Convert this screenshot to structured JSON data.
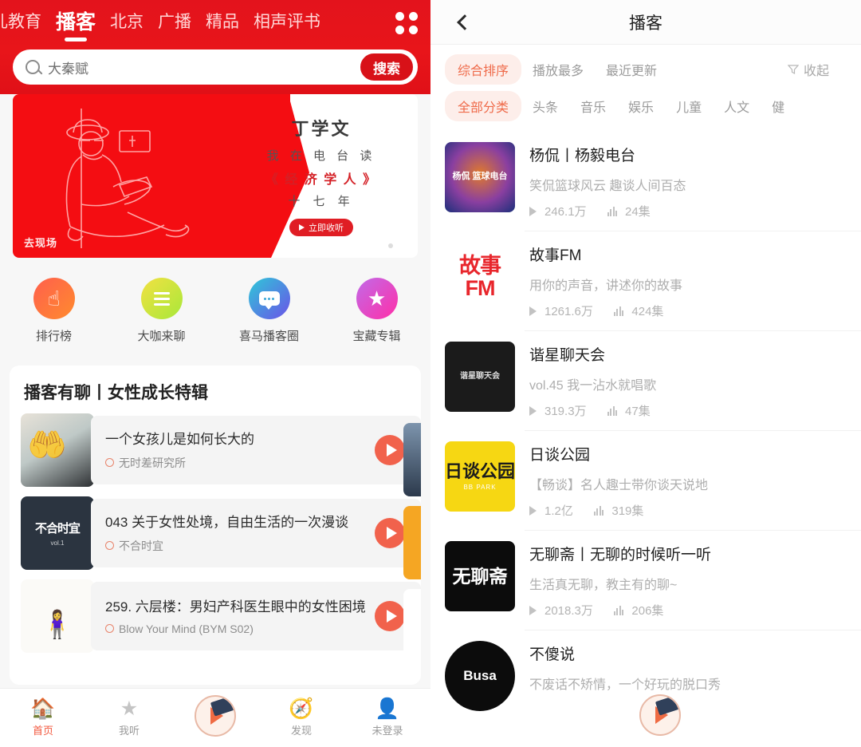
{
  "left": {
    "top_tabs": [
      {
        "label": "少儿教育",
        "active": false
      },
      {
        "label": "播客",
        "active": true
      },
      {
        "label": "北京",
        "active": false
      },
      {
        "label": "广播",
        "active": false
      },
      {
        "label": "精品",
        "active": false
      },
      {
        "label": "相声评书",
        "active": false
      }
    ],
    "grid_icon": "grid-apps-icon",
    "search": {
      "icon": "search-icon",
      "value": "大秦赋",
      "button_label": "搜索"
    },
    "banner": {
      "name": "丁学文",
      "line2": "我 在 电 台 读",
      "line3": "《 经 济 学 人 》",
      "line4": "十 七 年",
      "cta_label": "立即收听",
      "brand": "去现场",
      "dots": 3,
      "active_dot": 1
    },
    "entries": [
      {
        "label": "排行榜",
        "icon": "hand-tap-icon"
      },
      {
        "label": "大咖来聊",
        "icon": "list-lines-icon"
      },
      {
        "label": "喜马播客圈",
        "icon": "speech-bubble-icon"
      },
      {
        "label": "宝藏专辑",
        "icon": "star-icon"
      }
    ],
    "section": {
      "title": "播客有聊丨女性成长特辑",
      "rows": [
        {
          "title": "一个女孩儿是如何长大的",
          "source": "无时差研究所",
          "play_icon": "play-button-icon"
        },
        {
          "title": "043 关于女性处境，自由生活的一次漫谈",
          "source": "不合时宜",
          "cover_text": "不合时宜",
          "cover_sub": "vol.1",
          "play_icon": "play-button-icon"
        },
        {
          "title": "259. 六层楼：男妇产科医生眼中的女性困境",
          "source": "Blow Your Mind (BYM S02)",
          "play_icon": "play-button-icon"
        }
      ]
    },
    "tabbar": [
      {
        "label": "首页",
        "icon": "home-icon",
        "active": true
      },
      {
        "label": "我听",
        "icon": "star-icon",
        "active": false
      },
      {
        "label": "",
        "icon": "player-fab-icon",
        "active": false
      },
      {
        "label": "发现",
        "icon": "compass-icon",
        "active": false
      },
      {
        "label": "未登录",
        "icon": "user-icon",
        "active": false
      }
    ]
  },
  "right": {
    "header": {
      "back_icon": "back-chevron-icon",
      "title": "播客"
    },
    "sort_filters": [
      {
        "label": "综合排序",
        "active": true
      },
      {
        "label": "播放最多",
        "active": false
      },
      {
        "label": "最近更新",
        "active": false
      }
    ],
    "collapse": {
      "label": "收起",
      "icon": "funnel-icon"
    },
    "category_filters": [
      {
        "label": "全部分类",
        "active": true
      },
      {
        "label": "头条",
        "active": false
      },
      {
        "label": "音乐",
        "active": false
      },
      {
        "label": "娱乐",
        "active": false
      },
      {
        "label": "儿童",
        "active": false
      },
      {
        "label": "人文",
        "active": false
      },
      {
        "label": "健",
        "active": false
      }
    ],
    "podcasts": [
      {
        "title": "杨侃丨杨毅电台",
        "desc": "笑侃篮球风云 趣谈人间百态",
        "plays": "246.1万",
        "episodes": "24集",
        "cover_kind": "cv1",
        "cover_text": "杨侃 篮球电台"
      },
      {
        "title": "故事FM",
        "desc": "用你的声音，讲述你的故事",
        "plays": "1261.6万",
        "episodes": "424集",
        "cover_kind": "cv2",
        "cover_text": "故事FM"
      },
      {
        "title": "谐星聊天会",
        "desc": "vol.45 我一沾水就唱歌",
        "plays": "319.3万",
        "episodes": "47集",
        "cover_kind": "cv3",
        "cover_text": "谐星聊天会"
      },
      {
        "title": "日谈公园",
        "desc": "【畅谈】名人趣士带你谈天说地",
        "plays": "1.2亿",
        "episodes": "319集",
        "cover_kind": "cv4",
        "cover_text": "日谈公园",
        "cover_sub": "BB PARK"
      },
      {
        "title": "无聊斋丨无聊的时候听一听",
        "desc": "生活真无聊，教主有的聊~",
        "plays": "2018.3万",
        "episodes": "206集",
        "cover_kind": "cv5",
        "cover_text": "无聊斋"
      },
      {
        "title": "不傻说",
        "desc": "不废话不矫情，一个好玩的脱口秀",
        "plays": "",
        "episodes": "",
        "cover_kind": "cv6",
        "cover_text": "Busa"
      }
    ],
    "fab_icon": "player-fab-icon"
  },
  "colors": {
    "brand_red": "#e8151a",
    "banner_red": "#f40d12",
    "accent_orange": "#ef6b4a",
    "play_red": "#f1624c"
  }
}
